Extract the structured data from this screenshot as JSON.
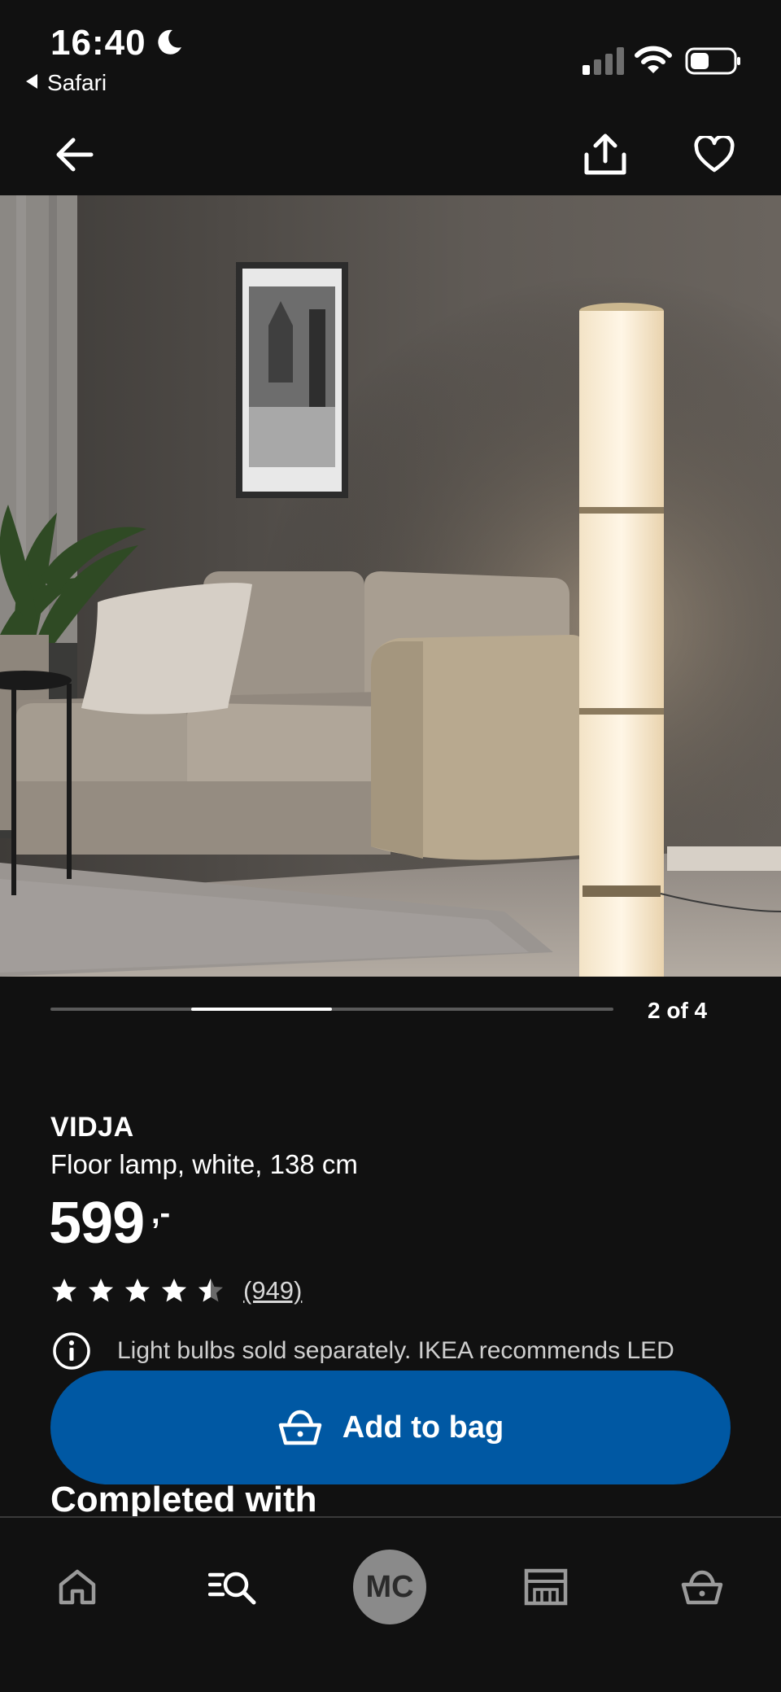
{
  "status_bar": {
    "time": "16:40",
    "back_app": "Safari"
  },
  "header": {
    "back_icon": "arrow-left-icon",
    "share_icon": "share-icon",
    "favorite_icon": "heart-icon"
  },
  "product": {
    "image_alt": "VIDJA floor lamp lit beside a beige sofa",
    "carousel_current": 2,
    "carousel_total": 4,
    "carousel_label": "2 of 4",
    "name": "VIDJA",
    "description": "Floor lamp, white, 138 cm",
    "price": "599",
    "price_suffix": ",-",
    "rating_value": 4.5,
    "rating_max": 5,
    "review_count": "(949)",
    "info_text": "Light bulbs sold separately. IKEA recommends LED"
  },
  "actions": {
    "add_to_bag": "Add to bag"
  },
  "section": {
    "heading": "Completed with"
  },
  "bottom_nav": {
    "items": [
      {
        "icon": "home-icon"
      },
      {
        "icon": "search-list-icon"
      },
      {
        "avatar_initials": "MC"
      },
      {
        "icon": "store-icon"
      },
      {
        "icon": "basket-icon"
      }
    ]
  },
  "colors": {
    "background": "#111111",
    "accent_blue": "#0058a3",
    "text": "#ffffff",
    "muted_text": "#cfcfcf"
  }
}
